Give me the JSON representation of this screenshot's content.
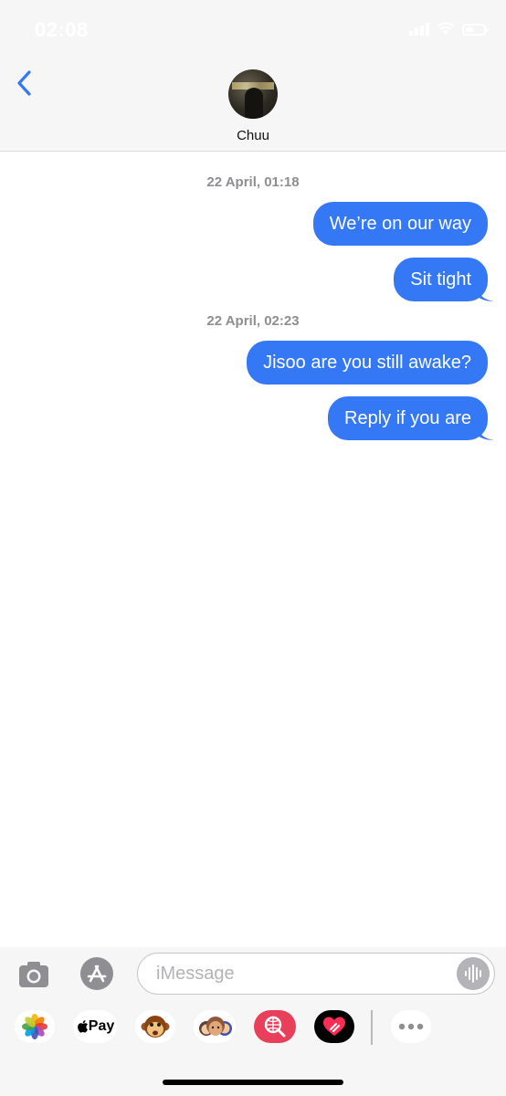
{
  "status_bar": {
    "time": "02:08"
  },
  "contact": {
    "name": "Chuu"
  },
  "messages": [
    {
      "timestamp": "22 April, 01:18"
    },
    {
      "text": "We’re on our way"
    },
    {
      "text": "Sit tight"
    },
    {
      "timestamp": "22 April, 02:23"
    },
    {
      "text": "Jisoo are you still awake?"
    },
    {
      "text": "Reply if you are"
    }
  ],
  "composer": {
    "placeholder": "iMessage"
  },
  "apps": [
    {
      "icon": "photos-icon"
    },
    {
      "label": "Pay",
      "icon": "apple-pay-icon"
    },
    {
      "icon": "animoji-icon"
    },
    {
      "icon": "memoji-icon"
    },
    {
      "icon": "images-search-icon"
    },
    {
      "icon": "digital-touch-icon"
    },
    {
      "icon": "more-icon"
    }
  ],
  "colors": {
    "bubble": "#3478f6",
    "tint": "#3478f6",
    "background": "#ffffff",
    "bar": "#f6f6f6"
  }
}
